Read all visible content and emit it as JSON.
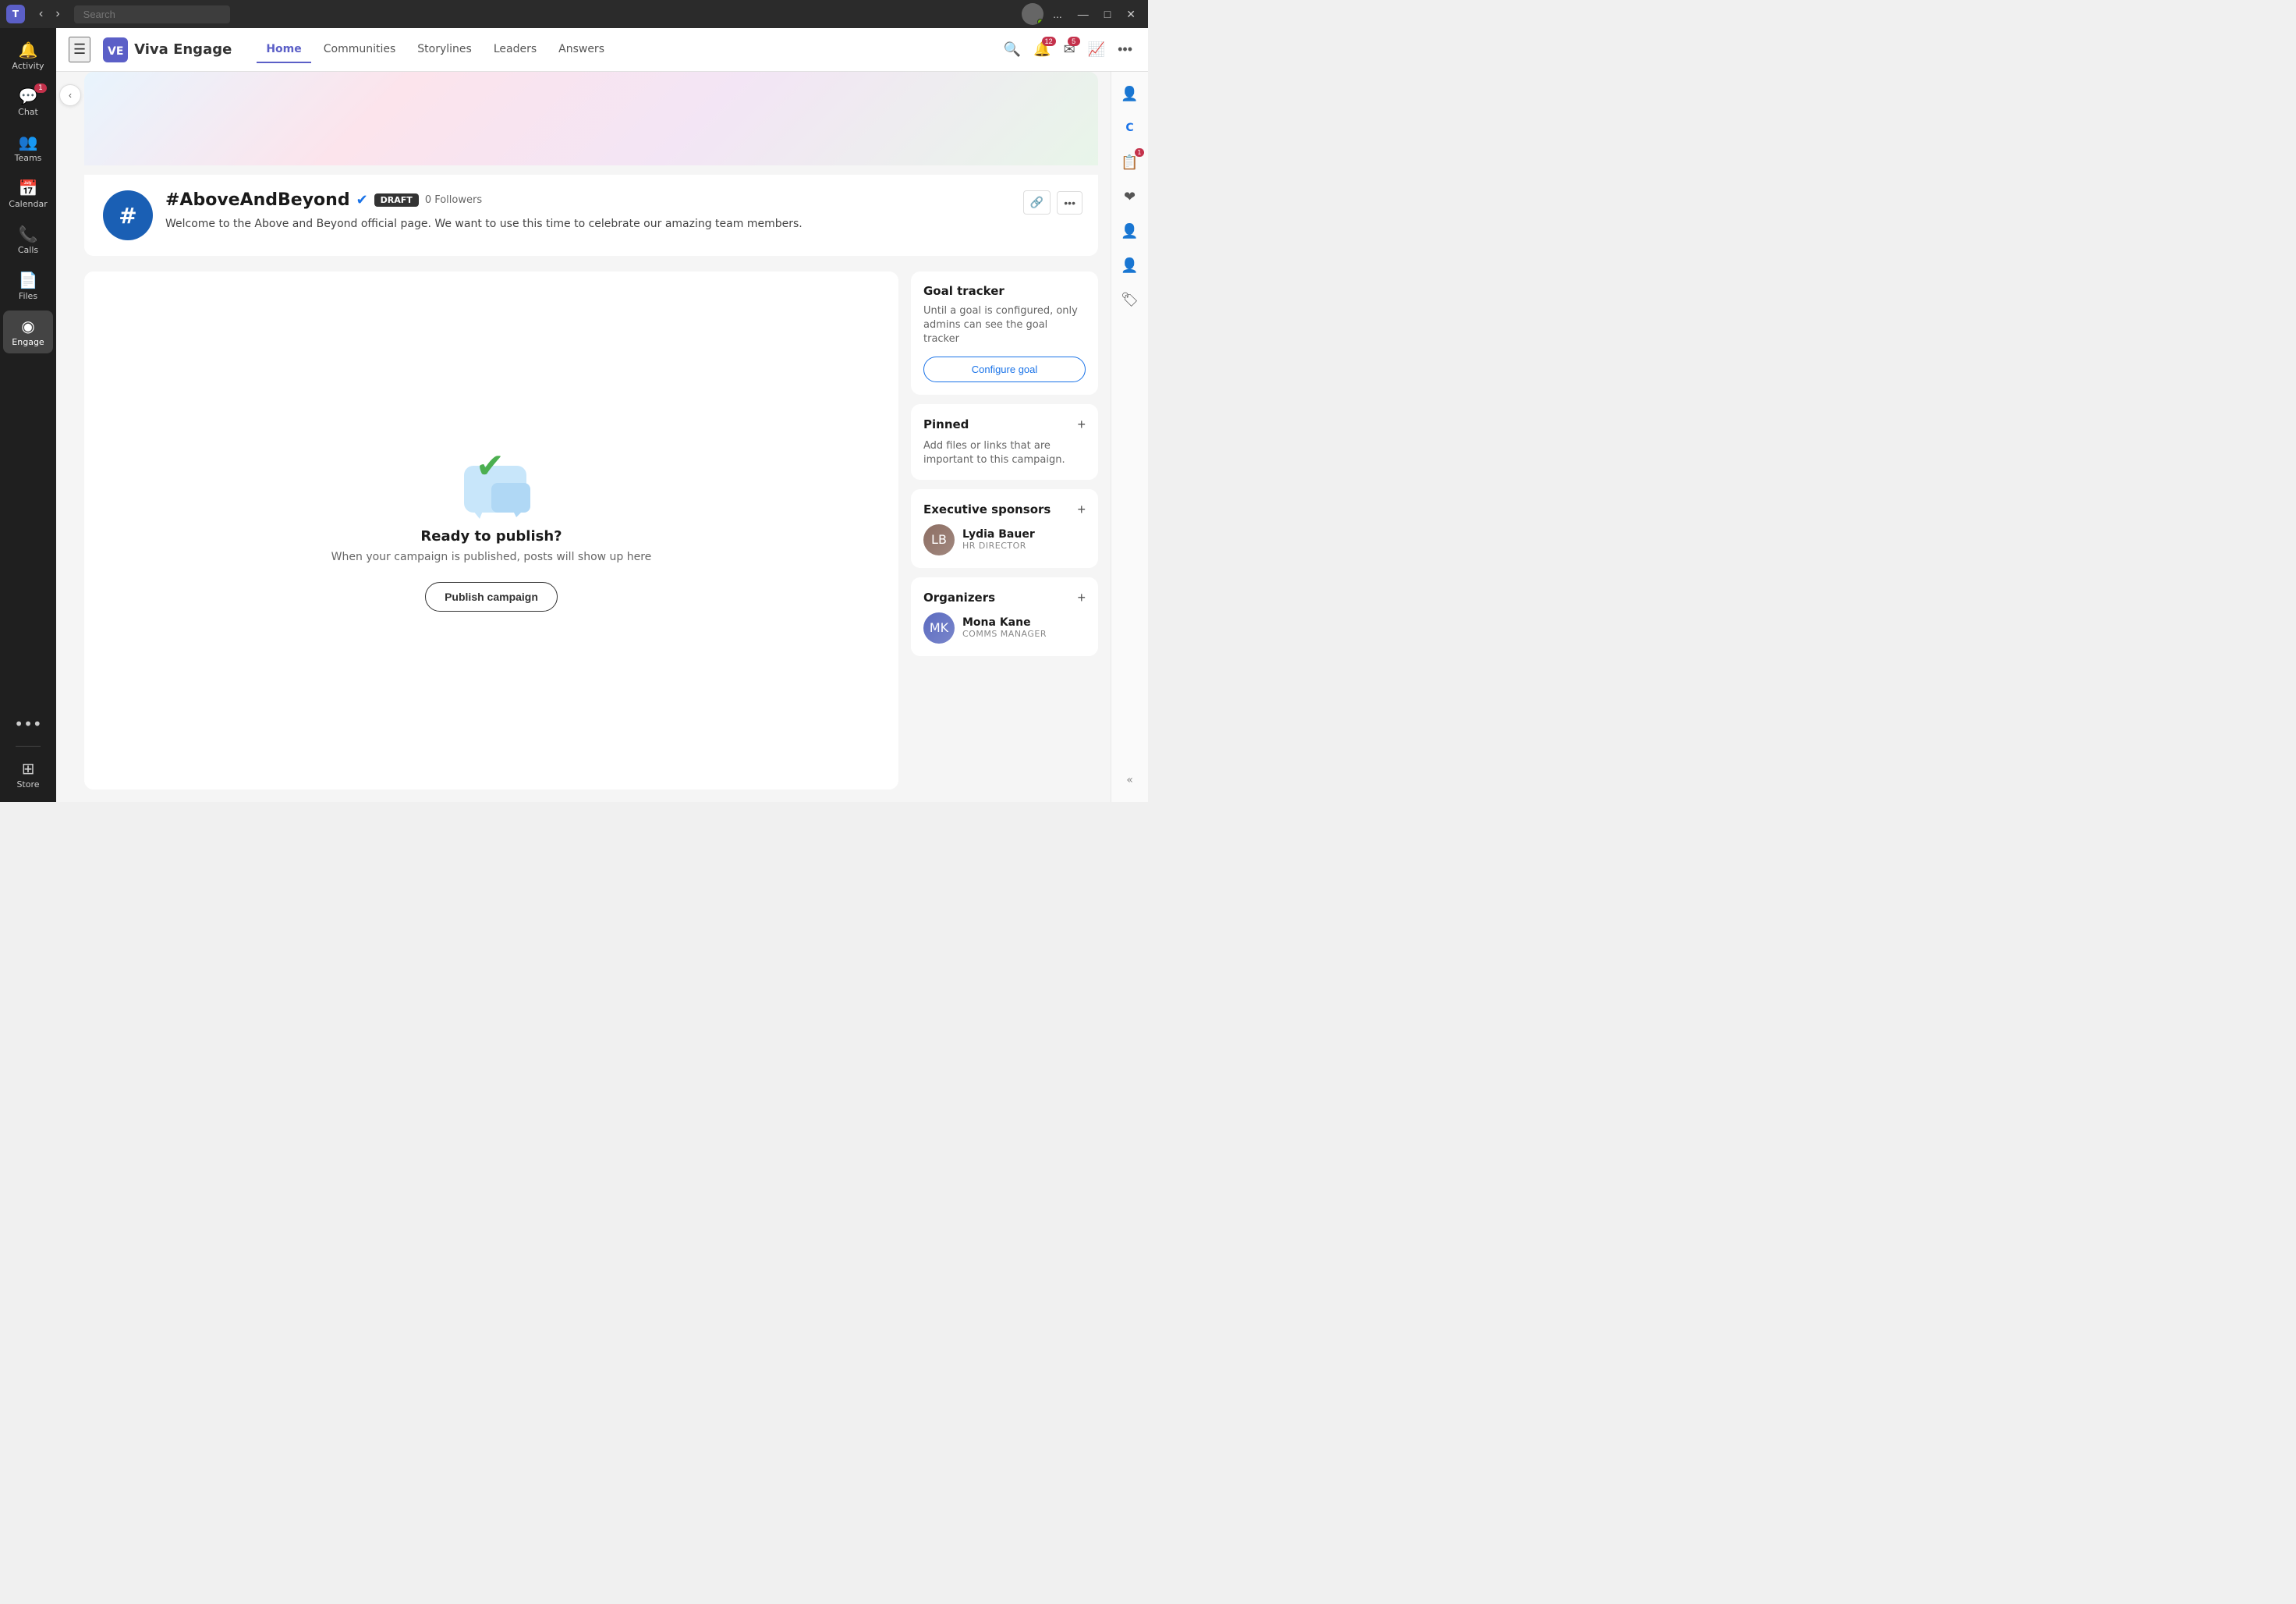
{
  "titlebar": {
    "search_placeholder": "Search",
    "more_label": "...",
    "minimize_label": "—",
    "maximize_label": "□",
    "close_label": "✕"
  },
  "sidebar": {
    "items": [
      {
        "id": "activity",
        "label": "Activity",
        "icon": "🔔",
        "badge": null
      },
      {
        "id": "chat",
        "label": "Chat",
        "icon": "💬",
        "badge": "1"
      },
      {
        "id": "teams",
        "label": "Teams",
        "icon": "👥",
        "badge": null
      },
      {
        "id": "calendar",
        "label": "Calendar",
        "icon": "📅",
        "badge": null
      },
      {
        "id": "calls",
        "label": "Calls",
        "icon": "📞",
        "badge": null
      },
      {
        "id": "files",
        "label": "Files",
        "icon": "📄",
        "badge": null
      },
      {
        "id": "engage",
        "label": "Engage",
        "icon": "◉",
        "badge": null,
        "active": true
      }
    ],
    "more_label": "•••",
    "store_label": "Store",
    "store_icon": "⊞"
  },
  "topbar": {
    "logo_text": "Viva Engage",
    "nav_items": [
      {
        "id": "home",
        "label": "Home",
        "active": true
      },
      {
        "id": "communities",
        "label": "Communities",
        "active": false
      },
      {
        "id": "storylines",
        "label": "Storylines",
        "active": false
      },
      {
        "id": "leaders",
        "label": "Leaders",
        "active": false
      },
      {
        "id": "answers",
        "label": "Answers",
        "active": false
      }
    ],
    "actions": {
      "search_icon": "🔍",
      "bell_icon": "🔔",
      "bell_badge": "12",
      "mail_icon": "✉",
      "mail_badge": "5",
      "chart_icon": "📈",
      "more_icon": "•••"
    }
  },
  "campaign": {
    "name": "#AboveAndBeyond",
    "verified": true,
    "status": "DRAFT",
    "followers": "0 Followers",
    "description": "Welcome to the Above and Beyond official page. We want to use this time to celebrate our amazing team members.",
    "logo_symbol": "#"
  },
  "publish_section": {
    "title": "Ready to publish?",
    "subtitle": "When your campaign is published, posts will show up here",
    "button_label": "Publish campaign"
  },
  "goal_tracker": {
    "title": "Goal tracker",
    "description": "Until a goal is configured, only admins can see the goal tracker",
    "configure_label": "Configure goal"
  },
  "pinned": {
    "title": "Pinned",
    "description": "Add files or links that are important to this campaign."
  },
  "executive_sponsors": {
    "title": "Executive sponsors",
    "people": [
      {
        "name": "Lydia Bauer",
        "role": "HR DIRECTOR",
        "initials": "LB"
      }
    ]
  },
  "organizers": {
    "title": "Organizers",
    "people": [
      {
        "name": "Mona Kane",
        "role": "COMMS MANAGER",
        "initials": "MK"
      }
    ]
  },
  "right_panel": {
    "items": [
      {
        "id": "user-avatar",
        "icon": "👤"
      },
      {
        "id": "app1",
        "icon": "©"
      },
      {
        "id": "app2",
        "icon": "📋",
        "badge": "1"
      },
      {
        "id": "app3",
        "icon": "❤"
      },
      {
        "id": "app4",
        "icon": "👤"
      },
      {
        "id": "app5",
        "icon": "👤"
      },
      {
        "id": "app6",
        "icon": "🏷"
      }
    ],
    "collapse_icon": "«"
  },
  "collapse_btn": "‹"
}
